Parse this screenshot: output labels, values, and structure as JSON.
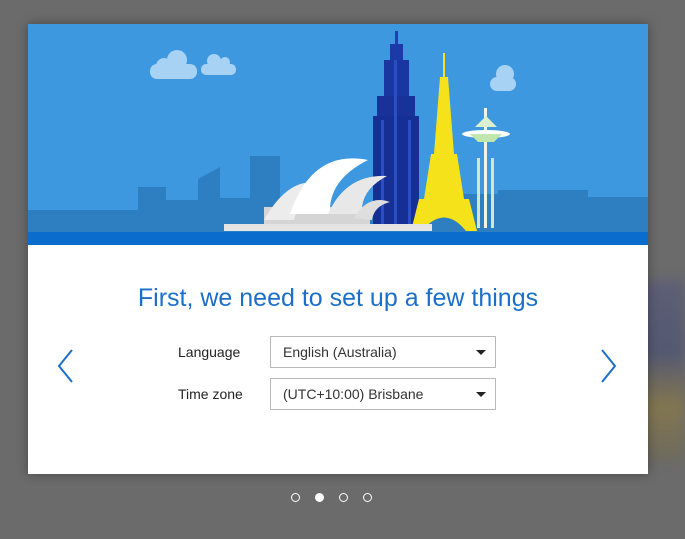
{
  "setup": {
    "title": "First, we need to set up a few things",
    "language": {
      "label": "Language",
      "value": "English (Australia)"
    },
    "timezone": {
      "label": "Time zone",
      "value": "(UTC+10:00) Brisbane"
    }
  },
  "pager": {
    "total_pages": 4,
    "active_page": 2
  },
  "icons": {
    "prev": "chevron-left-icon",
    "next": "chevron-right-icon",
    "dropdown": "caret-down-icon"
  },
  "colors": {
    "accent": "#1b6fc9",
    "banner_sky": "#3d98e0",
    "banner_strip": "#0a6dce",
    "backdrop": "#6b6b6b"
  }
}
